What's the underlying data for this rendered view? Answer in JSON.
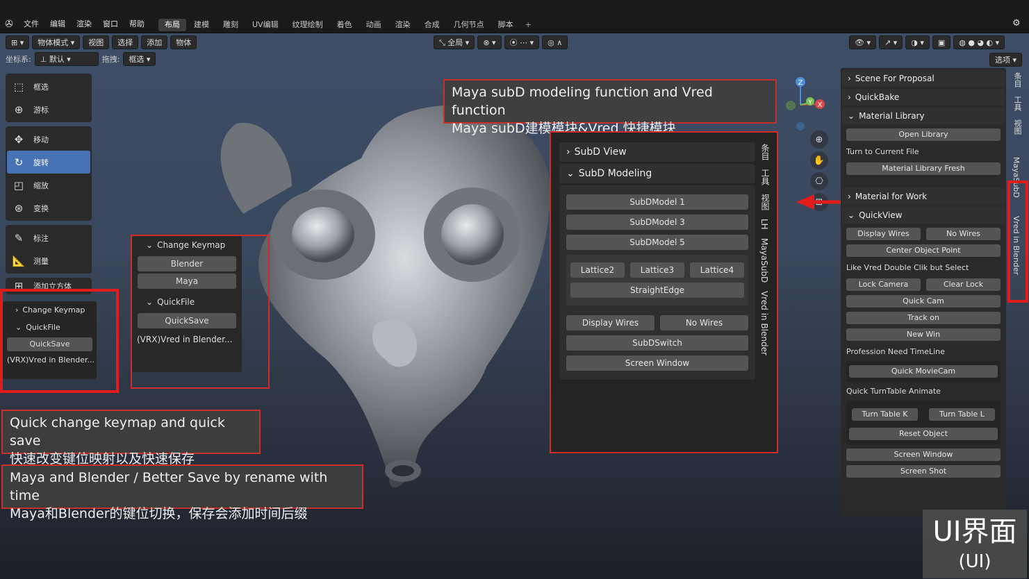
{
  "menu": {
    "items": [
      "文件",
      "编辑",
      "渲染",
      "窗口",
      "帮助"
    ],
    "workspaces": [
      "布局",
      "建模",
      "雕刻",
      "UV编辑",
      "纹理绘制",
      "着色",
      "动画",
      "渲染",
      "合成",
      "几何节点",
      "脚本"
    ],
    "add_tab": "+"
  },
  "header": {
    "mode": "物体模式",
    "menus": [
      "视图",
      "选择",
      "添加",
      "物体"
    ],
    "coord_label": "坐标系:",
    "coord_value": "默认",
    "drag_label": "拖拽:",
    "drag_value": "框选",
    "pivot": "全局",
    "options": "选项"
  },
  "toolbar": {
    "tools": [
      {
        "label": "框选",
        "icon": "box-select-icon",
        "active": false
      },
      {
        "label": "游标",
        "icon": "cursor-icon",
        "active": false
      },
      {
        "label": "移动",
        "icon": "move-icon",
        "active": false
      },
      {
        "label": "旋转",
        "icon": "rotate-icon",
        "active": true
      },
      {
        "label": "缩放",
        "icon": "scale-icon",
        "active": false
      },
      {
        "label": "变换",
        "icon": "transform-icon",
        "active": false
      },
      {
        "label": "标注",
        "icon": "annotate-icon",
        "active": false
      },
      {
        "label": "测量",
        "icon": "measure-icon",
        "active": false
      },
      {
        "label": "添加立方体",
        "icon": "add-cube-icon",
        "active": false
      }
    ]
  },
  "left_small_panel": {
    "change_keymap": "Change Keymap",
    "quickfile": "QuickFile",
    "quicksave": "QuickSave",
    "vred": "(VRX)Vred in Blender..."
  },
  "keymap_panel": {
    "change_keymap": "Change Keymap",
    "blender": "Blender",
    "maya": "Maya",
    "quickfile": "QuickFile",
    "quicksave": "QuickSave",
    "vred": "(VRX)Vred in Blender..."
  },
  "captions": {
    "top_line1": "Maya subD modeling function and Vred function",
    "top_line2": "Maya subD建模模块&Vred 快捷模块",
    "mid_line1": "Quick change keymap and quick save",
    "mid_line2": "快速改变键位映射以及快速保存",
    "bottom_line1": "Maya and Blender / Better Save by rename with time",
    "bottom_line2": "Maya和Blender的键位切换，保存会添加时间后缀"
  },
  "subd_panel": {
    "subd_view": "SubD View",
    "subd_modeling": "SubD Modeling",
    "model1": "SubDModel 1",
    "model3": "SubDModel 3",
    "model5": "SubDModel 5",
    "lattice2": "Lattice2",
    "lattice3": "Lattice3",
    "lattice4": "Lattice4",
    "straight": "StraightEdge",
    "display_wires": "Display Wires",
    "no_wires": "No Wires",
    "subd_switch": "SubDSwitch",
    "screen_window": "Screen Window",
    "tabs": [
      "条目",
      "工具",
      "视图",
      "LH",
      "MayaSubD",
      "Vred in Blender"
    ]
  },
  "right_panel": {
    "scene_for_proposal": "Scene For Proposal",
    "quickbake": "QuickBake",
    "material_library": "Material Library",
    "open_library": "Open Library",
    "turn_to_current": "Turn to Current File",
    "material_fresh": "Material Library Fresh",
    "material_for_work": "Material for Work",
    "quickview": "QuickView",
    "display_wires": "Display Wires",
    "no_wires": "No Wires",
    "center_object": "Center Object Point",
    "like_vred": "Like Vred Double Clik but Select",
    "lock_camera": "Lock Camera",
    "clear_lock": "Clear Lock",
    "quick_cam": "Quick Cam",
    "track_on": "Track on",
    "new_win": "New Win",
    "profession": "Profession Need TimeLine",
    "quick_moviecam": "Quick MovieCam",
    "quick_turntable": "Quick TurnTable Animate",
    "turn_table_k": "Turn Table K",
    "turn_table_l": "Turn Table L",
    "reset_object": "Reset Object",
    "screen_window": "Screen Window",
    "screen_shot": "Screen Shot"
  },
  "right_tabs": [
    "条目",
    "工具",
    "视图",
    "MayaSubD",
    "Vred in Blender"
  ],
  "gizmo": {
    "x": "X",
    "y": "Y",
    "z": "Z"
  },
  "badge": {
    "big": "UI界面",
    "small": "(UI)"
  },
  "colors": {
    "accent": "#4772b3",
    "highlight_red": "#e21b1b"
  }
}
